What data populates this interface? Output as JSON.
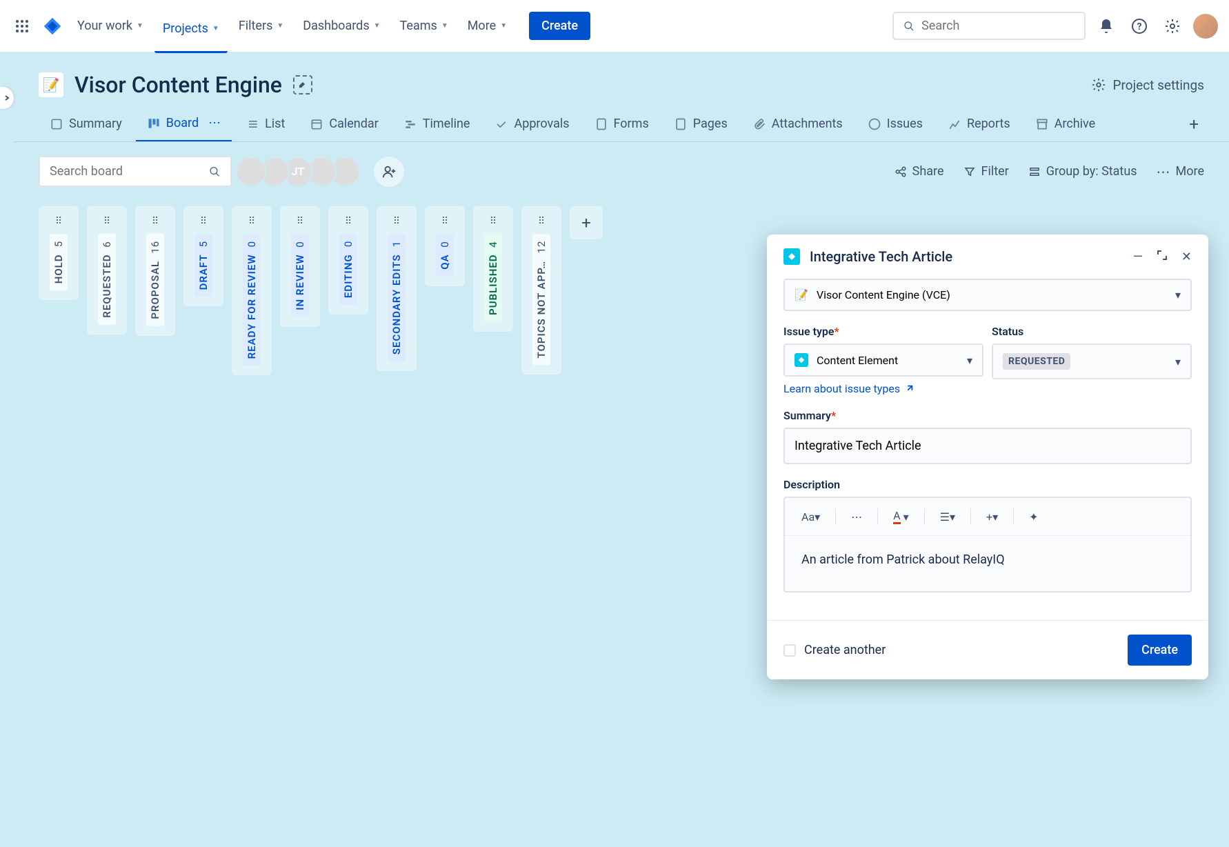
{
  "nav": {
    "your_work": "Your work",
    "projects": "Projects",
    "filters": "Filters",
    "dashboards": "Dashboards",
    "teams": "Teams",
    "more": "More",
    "create": "Create",
    "search_placeholder": "Search"
  },
  "project": {
    "title": "Visor Content Engine",
    "settings": "Project settings"
  },
  "tabs": {
    "summary": "Summary",
    "board": "Board",
    "list": "List",
    "calendar": "Calendar",
    "timeline": "Timeline",
    "approvals": "Approvals",
    "forms": "Forms",
    "pages": "Pages",
    "attachments": "Attachments",
    "issues": "Issues",
    "reports": "Reports",
    "archive": "Archive"
  },
  "board_toolbar": {
    "search_placeholder": "Search board",
    "share": "Share",
    "filter": "Filter",
    "group_by": "Group by: Status",
    "more": "More",
    "avatar_initials": "JT"
  },
  "columns": [
    {
      "name": "HOLD",
      "count": 5,
      "style": "default"
    },
    {
      "name": "REQUESTED",
      "count": 6,
      "style": "default"
    },
    {
      "name": "PROPOSAL",
      "count": 16,
      "style": "default"
    },
    {
      "name": "DRAFT",
      "count": 5,
      "style": "blue"
    },
    {
      "name": "READY FOR REVIEW",
      "count": 0,
      "style": "blue"
    },
    {
      "name": "IN REVIEW",
      "count": 0,
      "style": "blue"
    },
    {
      "name": "EDITING",
      "count": 0,
      "style": "blue"
    },
    {
      "name": "SECONDARY EDITS",
      "count": 1,
      "style": "blue"
    },
    {
      "name": "QA",
      "count": 0,
      "style": "blue"
    },
    {
      "name": "PUBLISHED",
      "count": 4,
      "style": "green"
    },
    {
      "name": "TOPICS NOT APP…",
      "count": 12,
      "style": "default"
    }
  ],
  "modal": {
    "title": "Integrative Tech Article",
    "project_label": "Visor Content Engine (VCE)",
    "issue_type_label": "Issue type",
    "issue_type_value": "Content Element",
    "status_label": "Status",
    "status_value": "REQUESTED",
    "learn_link": "Learn about issue types",
    "summary_label": "Summary",
    "summary_value": "Integrative Tech Article",
    "description_label": "Description",
    "description_value": "An article from Patrick about RelayIQ",
    "create_another": "Create another",
    "create": "Create"
  }
}
